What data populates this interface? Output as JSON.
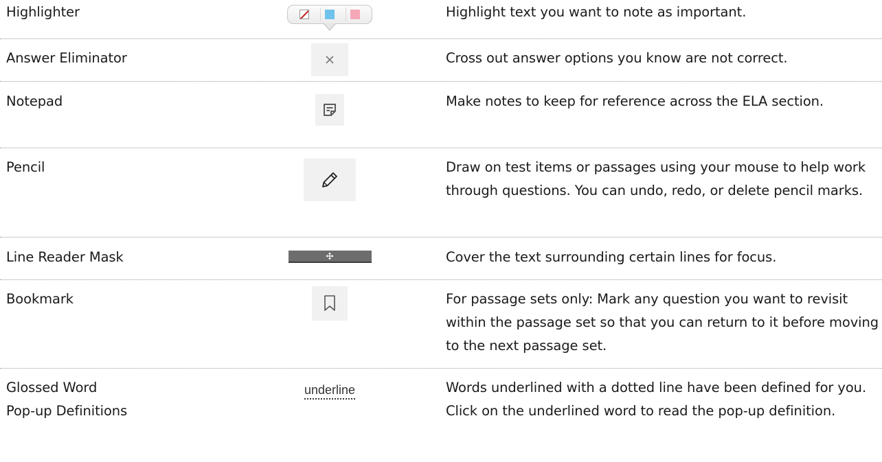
{
  "tools": [
    {
      "name_lines": [
        "Highlighter"
      ],
      "icon": "highlighter-palette-icon",
      "description": "Highlight text you want to note as important."
    },
    {
      "name_lines": [
        "Answer Eliminator"
      ],
      "icon": "close-icon",
      "description": "Cross out answer options you know are not correct."
    },
    {
      "name_lines": [
        "Notepad"
      ],
      "icon": "notepad-icon",
      "description": "Make notes to keep for reference across the ELA section."
    },
    {
      "name_lines": [
        "Pencil"
      ],
      "icon": "pencil-icon",
      "description": "Draw on test items or passages using your mouse to help work through questions. You can undo, redo, or delete pencil marks."
    },
    {
      "name_lines": [
        "Line Reader Mask"
      ],
      "icon": "move-arrows-icon",
      "description": "Cover the text surrounding certain lines for focus."
    },
    {
      "name_lines": [
        "Bookmark"
      ],
      "icon": "bookmark-icon",
      "description": "For passage sets only: Mark any question you want to revisit within the passage set so that you can return to it before moving to the next passage set."
    },
    {
      "name_lines": [
        "Glossed Word",
        "Pop-up Definitions"
      ],
      "icon_text": "underline",
      "description": "Words underlined with a dotted line have been defined for you. Click on the underlined word to read the pop-up definition."
    }
  ],
  "colors": {
    "highlight_blue": "#6fc2ea",
    "highlight_pink": "#f5a7b7",
    "eraser_red": "#c01c1c"
  }
}
